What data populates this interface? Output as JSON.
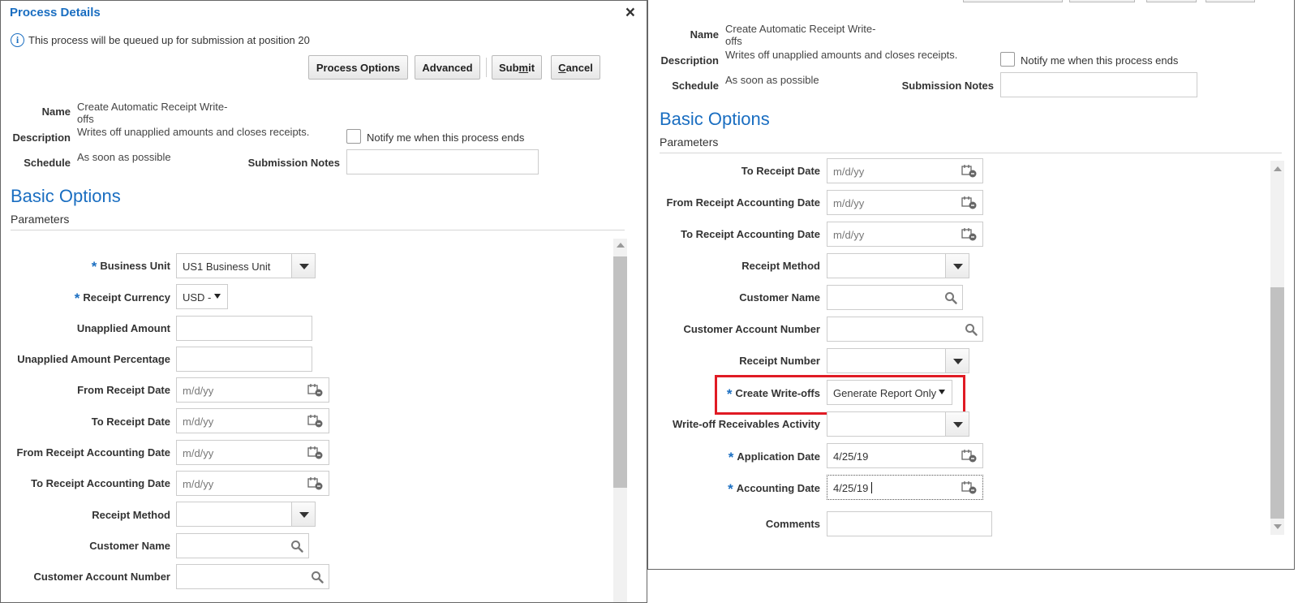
{
  "dialog": {
    "title": "Process Details",
    "close_symbol": "×",
    "info_message": "This process will be queued up for submission at position 20",
    "buttons": {
      "process_options": "Process Options",
      "advanced": "Advanced",
      "submit_pre": "Sub",
      "submit_access": "m",
      "submit_post": "it",
      "cancel_access": "C",
      "cancel_post": "ancel"
    }
  },
  "header": {
    "name_label": "Name",
    "name_value_line1": "Create Automatic Receipt Write-",
    "name_value_line2": "offs",
    "description_label": "Description",
    "description_value": "Writes off unapplied amounts and closes receipts.",
    "schedule_label": "Schedule",
    "schedule_value": "As soon as possible",
    "notify_label": "Notify me when this process ends",
    "submission_notes_label": "Submission Notes"
  },
  "basic_options": {
    "title": "Basic Options",
    "parameters_label": "Parameters"
  },
  "params": {
    "business_unit_label": "Business Unit",
    "business_unit_value": "US1 Business Unit",
    "receipt_currency_label": "Receipt Currency",
    "receipt_currency_value": "USD -",
    "unapplied_amount_label": "Unapplied Amount",
    "unapplied_amount_pct_label": "Unapplied Amount Percentage",
    "from_receipt_date_label": "From Receipt Date",
    "to_receipt_date_label": "To Receipt Date",
    "from_receipt_acct_date_label": "From Receipt Accounting Date",
    "to_receipt_acct_date_label": "To Receipt Accounting Date",
    "date_placeholder": "m/d/yy",
    "receipt_method_label": "Receipt Method",
    "customer_name_label": "Customer Name",
    "customer_account_number_label": "Customer Account Number",
    "receipt_number_label": "Receipt Number",
    "create_writeoffs_label": "Create Write-offs",
    "create_writeoffs_value": "Generate Report Only",
    "writeoff_activity_label": "Write-off Receivables Activity",
    "application_date_label": "Application Date",
    "application_date_value": "4/25/19",
    "accounting_date_label": "Accounting Date",
    "accounting_date_value": "4/25/19",
    "comments_label": "Comments"
  },
  "required_marker": "*",
  "icons": {
    "info": "info-icon",
    "calendar": "calendar-icon",
    "search": "search-icon",
    "dropdown": "chevron-down-icon"
  },
  "colors": {
    "accent": "#1a6ec1",
    "highlight": "#e01b24"
  }
}
